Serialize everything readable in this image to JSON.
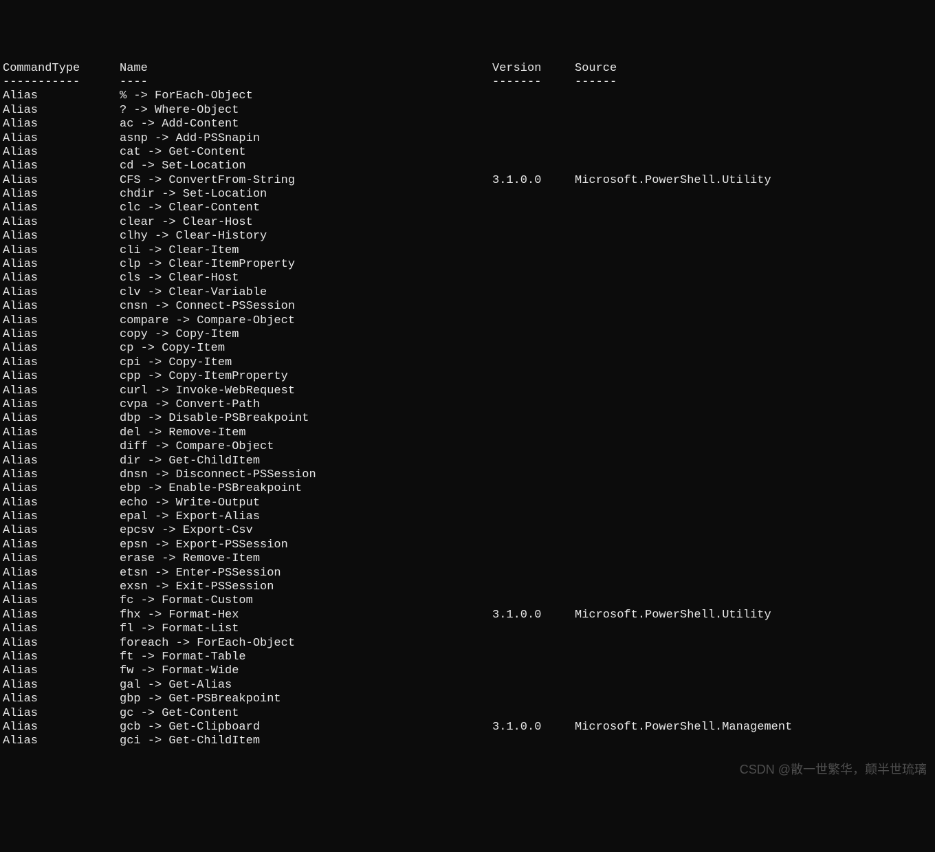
{
  "headers": {
    "commandType": "CommandType",
    "name": "Name",
    "version": "Version",
    "source": "Source"
  },
  "dividers": {
    "commandType": "-----------",
    "name": "----",
    "version": "-------",
    "source": "------"
  },
  "rows": [
    {
      "type": "Alias",
      "name": "% -> ForEach-Object",
      "version": "",
      "source": ""
    },
    {
      "type": "Alias",
      "name": "? -> Where-Object",
      "version": "",
      "source": ""
    },
    {
      "type": "Alias",
      "name": "ac -> Add-Content",
      "version": "",
      "source": ""
    },
    {
      "type": "Alias",
      "name": "asnp -> Add-PSSnapin",
      "version": "",
      "source": ""
    },
    {
      "type": "Alias",
      "name": "cat -> Get-Content",
      "version": "",
      "source": ""
    },
    {
      "type": "Alias",
      "name": "cd -> Set-Location",
      "version": "",
      "source": ""
    },
    {
      "type": "Alias",
      "name": "CFS -> ConvertFrom-String",
      "version": "3.1.0.0",
      "source": "Microsoft.PowerShell.Utility"
    },
    {
      "type": "Alias",
      "name": "chdir -> Set-Location",
      "version": "",
      "source": ""
    },
    {
      "type": "Alias",
      "name": "clc -> Clear-Content",
      "version": "",
      "source": ""
    },
    {
      "type": "Alias",
      "name": "clear -> Clear-Host",
      "version": "",
      "source": ""
    },
    {
      "type": "Alias",
      "name": "clhy -> Clear-History",
      "version": "",
      "source": ""
    },
    {
      "type": "Alias",
      "name": "cli -> Clear-Item",
      "version": "",
      "source": ""
    },
    {
      "type": "Alias",
      "name": "clp -> Clear-ItemProperty",
      "version": "",
      "source": ""
    },
    {
      "type": "Alias",
      "name": "cls -> Clear-Host",
      "version": "",
      "source": ""
    },
    {
      "type": "Alias",
      "name": "clv -> Clear-Variable",
      "version": "",
      "source": ""
    },
    {
      "type": "Alias",
      "name": "cnsn -> Connect-PSSession",
      "version": "",
      "source": ""
    },
    {
      "type": "Alias",
      "name": "compare -> Compare-Object",
      "version": "",
      "source": ""
    },
    {
      "type": "Alias",
      "name": "copy -> Copy-Item",
      "version": "",
      "source": ""
    },
    {
      "type": "Alias",
      "name": "cp -> Copy-Item",
      "version": "",
      "source": ""
    },
    {
      "type": "Alias",
      "name": "cpi -> Copy-Item",
      "version": "",
      "source": ""
    },
    {
      "type": "Alias",
      "name": "cpp -> Copy-ItemProperty",
      "version": "",
      "source": ""
    },
    {
      "type": "Alias",
      "name": "curl -> Invoke-WebRequest",
      "version": "",
      "source": ""
    },
    {
      "type": "Alias",
      "name": "cvpa -> Convert-Path",
      "version": "",
      "source": ""
    },
    {
      "type": "Alias",
      "name": "dbp -> Disable-PSBreakpoint",
      "version": "",
      "source": ""
    },
    {
      "type": "Alias",
      "name": "del -> Remove-Item",
      "version": "",
      "source": ""
    },
    {
      "type": "Alias",
      "name": "diff -> Compare-Object",
      "version": "",
      "source": ""
    },
    {
      "type": "Alias",
      "name": "dir -> Get-ChildItem",
      "version": "",
      "source": ""
    },
    {
      "type": "Alias",
      "name": "dnsn -> Disconnect-PSSession",
      "version": "",
      "source": ""
    },
    {
      "type": "Alias",
      "name": "ebp -> Enable-PSBreakpoint",
      "version": "",
      "source": ""
    },
    {
      "type": "Alias",
      "name": "echo -> Write-Output",
      "version": "",
      "source": ""
    },
    {
      "type": "Alias",
      "name": "epal -> Export-Alias",
      "version": "",
      "source": ""
    },
    {
      "type": "Alias",
      "name": "epcsv -> Export-Csv",
      "version": "",
      "source": ""
    },
    {
      "type": "Alias",
      "name": "epsn -> Export-PSSession",
      "version": "",
      "source": ""
    },
    {
      "type": "Alias",
      "name": "erase -> Remove-Item",
      "version": "",
      "source": ""
    },
    {
      "type": "Alias",
      "name": "etsn -> Enter-PSSession",
      "version": "",
      "source": ""
    },
    {
      "type": "Alias",
      "name": "exsn -> Exit-PSSession",
      "version": "",
      "source": ""
    },
    {
      "type": "Alias",
      "name": "fc -> Format-Custom",
      "version": "",
      "source": ""
    },
    {
      "type": "Alias",
      "name": "fhx -> Format-Hex",
      "version": "3.1.0.0",
      "source": "Microsoft.PowerShell.Utility"
    },
    {
      "type": "Alias",
      "name": "fl -> Format-List",
      "version": "",
      "source": ""
    },
    {
      "type": "Alias",
      "name": "foreach -> ForEach-Object",
      "version": "",
      "source": ""
    },
    {
      "type": "Alias",
      "name": "ft -> Format-Table",
      "version": "",
      "source": ""
    },
    {
      "type": "Alias",
      "name": "fw -> Format-Wide",
      "version": "",
      "source": ""
    },
    {
      "type": "Alias",
      "name": "gal -> Get-Alias",
      "version": "",
      "source": ""
    },
    {
      "type": "Alias",
      "name": "gbp -> Get-PSBreakpoint",
      "version": "",
      "source": ""
    },
    {
      "type": "Alias",
      "name": "gc -> Get-Content",
      "version": "",
      "source": ""
    },
    {
      "type": "Alias",
      "name": "gcb -> Get-Clipboard",
      "version": "3.1.0.0",
      "source": "Microsoft.PowerShell.Management"
    },
    {
      "type": "Alias",
      "name": "gci -> Get-ChildItem",
      "version": "",
      "source": ""
    }
  ],
  "watermark": "CSDN @散一世繁华，颠半世琉璃"
}
